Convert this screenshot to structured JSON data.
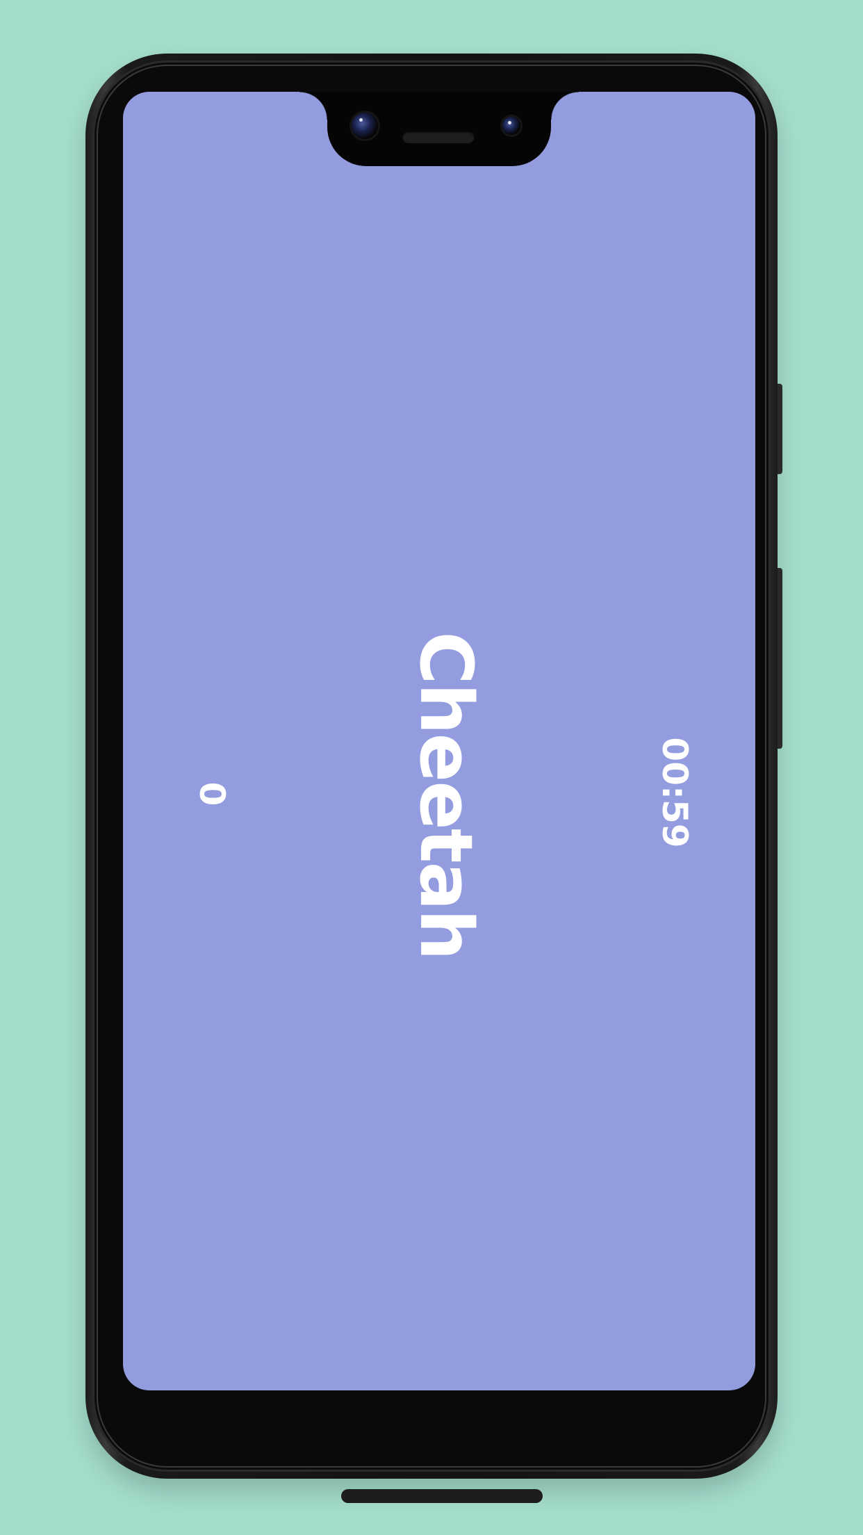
{
  "colors": {
    "background": "#a4ddcc",
    "screen": "#939cdf",
    "text": "#ffffff"
  },
  "game": {
    "word": "Cheetah",
    "timer": "00:59",
    "score": "0"
  }
}
